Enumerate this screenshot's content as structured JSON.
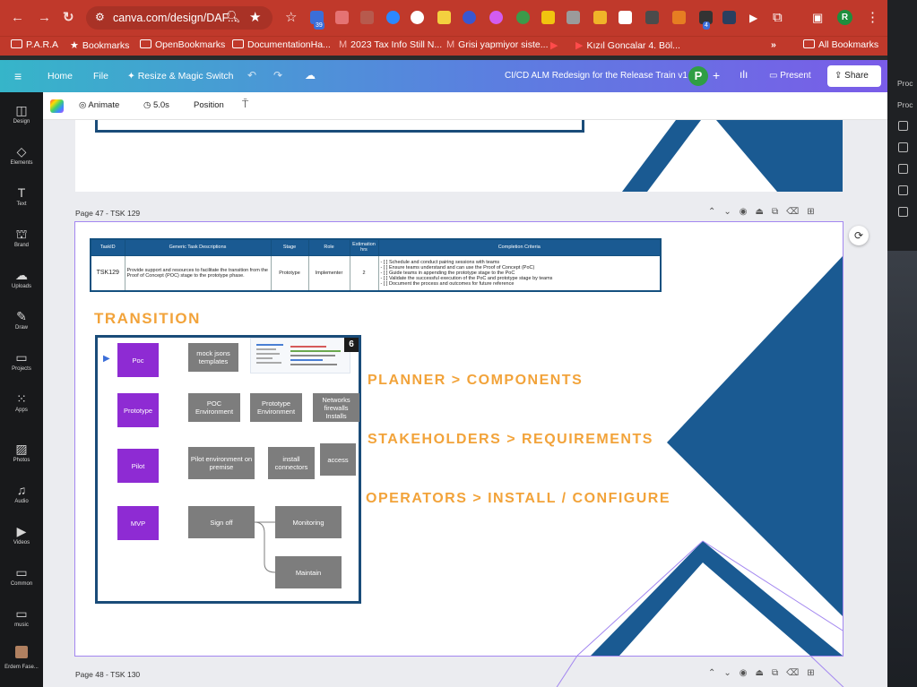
{
  "browser": {
    "url": "canva.com/design/DAF...",
    "ext_badge_1": "39",
    "ext_badge_2": "4",
    "profile_initial": "R"
  },
  "bookmarks": [
    {
      "label": "P.A.R.A",
      "icon": "folder-icon"
    },
    {
      "label": "Bookmarks",
      "icon": "star-icon"
    },
    {
      "label": "OpenBookmarks",
      "icon": "folder-icon"
    },
    {
      "label": "DocumentationHa...",
      "icon": "folder-icon"
    },
    {
      "label": "2023 Tax Info Still N...",
      "icon": "gmail-icon"
    },
    {
      "label": "Grisi yapmiyor siste...",
      "icon": "gmail-icon"
    },
    {
      "label": "",
      "icon": "youtube-icon"
    },
    {
      "label": "Kızıl Goncalar 4. Böl...",
      "icon": "youtube-icon"
    }
  ],
  "bookmarks_more": "»",
  "bookmarks_all": "All Bookmarks",
  "canva": {
    "home": "Home",
    "file": "File",
    "resize": "Resize & Magic Switch",
    "doc_title": "CI/CD ALM Redesign for the Release Train v1",
    "collaborator": "P",
    "present": "Present",
    "share": "Share"
  },
  "sidebar": [
    {
      "label": "Design",
      "icon": "design-icon"
    },
    {
      "label": "Elements",
      "icon": "elements-icon"
    },
    {
      "label": "Text",
      "icon": "text-icon"
    },
    {
      "label": "Brand",
      "icon": "brand-icon"
    },
    {
      "label": "Uploads",
      "icon": "uploads-icon"
    },
    {
      "label": "Draw",
      "icon": "draw-icon"
    },
    {
      "label": "Projects",
      "icon": "projects-icon"
    },
    {
      "label": "Apps",
      "icon": "apps-icon"
    },
    {
      "label": "Photos",
      "icon": "photos-icon"
    },
    {
      "label": "Audio",
      "icon": "audio-icon"
    },
    {
      "label": "Videos",
      "icon": "videos-icon"
    },
    {
      "label": "Common",
      "icon": "folder-icon"
    },
    {
      "label": "music",
      "icon": "folder-icon"
    },
    {
      "label": "Erdem Fase...",
      "icon": "avatar-icon"
    }
  ],
  "toolbar": {
    "animate": "Animate",
    "duration": "5.0s",
    "position": "Position"
  },
  "pages": {
    "current_label": "Page 47 - TSK 129",
    "next_label": "Page 48 - TSK 130"
  },
  "task_table": {
    "headers": [
      "TaskID",
      "Generic Task Descriptions",
      "Stage",
      "Role",
      "Estimation hrs",
      "Completion Criteria"
    ],
    "row": {
      "task_id": "TSK129",
      "description": "Provide support and resources to facilitate the transition from the Proof of Concept (POC) stage to the prototype phase.",
      "stage": "Prototype",
      "role": "Implementer",
      "estimation": "2",
      "criteria": [
        "- [ ]  Schedule and conduct pairing sessions with teams",
        "- [ ]  Ensure teams understand and can use the Proof of Concept (PoC)",
        "- [ ]  Guide teams in appending the prototype stage to the PoC",
        "- [ ]  Validate the successful execution of the PoC and prototype stage by teams",
        "- [ ]  Document the process and outcomes for future reference"
      ]
    }
  },
  "slide": {
    "title": "TRANSITION",
    "badge": "6",
    "flow": {
      "poc": "Poc",
      "mock": "mock jsons templates",
      "prototype": "Prototype",
      "poc_env": "POC Environment",
      "proto_env": "Prototype Environment",
      "networks": "Networks firewalls Installs",
      "pilot": "Pilot",
      "pilot_env": "Pilot environment on premise",
      "install_connectors": "install connectors",
      "access": "access",
      "mvp": "MVP",
      "sign_off": "Sign off",
      "monitoring": "Monitoring",
      "maintain": "Maintain"
    },
    "roles": [
      "PLANNER > COMPONENTS",
      "STAKEHOLDERS > REQUIREMENTS",
      "OPERATORS > INSTALL / CONFIGURE"
    ],
    "colors": {
      "accent": "#f2a33a",
      "navy": "#1a5a92",
      "purple": "#8e2bd3",
      "grey": "#7d7d7d",
      "selection": "#a387f0"
    }
  },
  "right_window": {
    "line1": "Proc",
    "line2": "Proc"
  }
}
